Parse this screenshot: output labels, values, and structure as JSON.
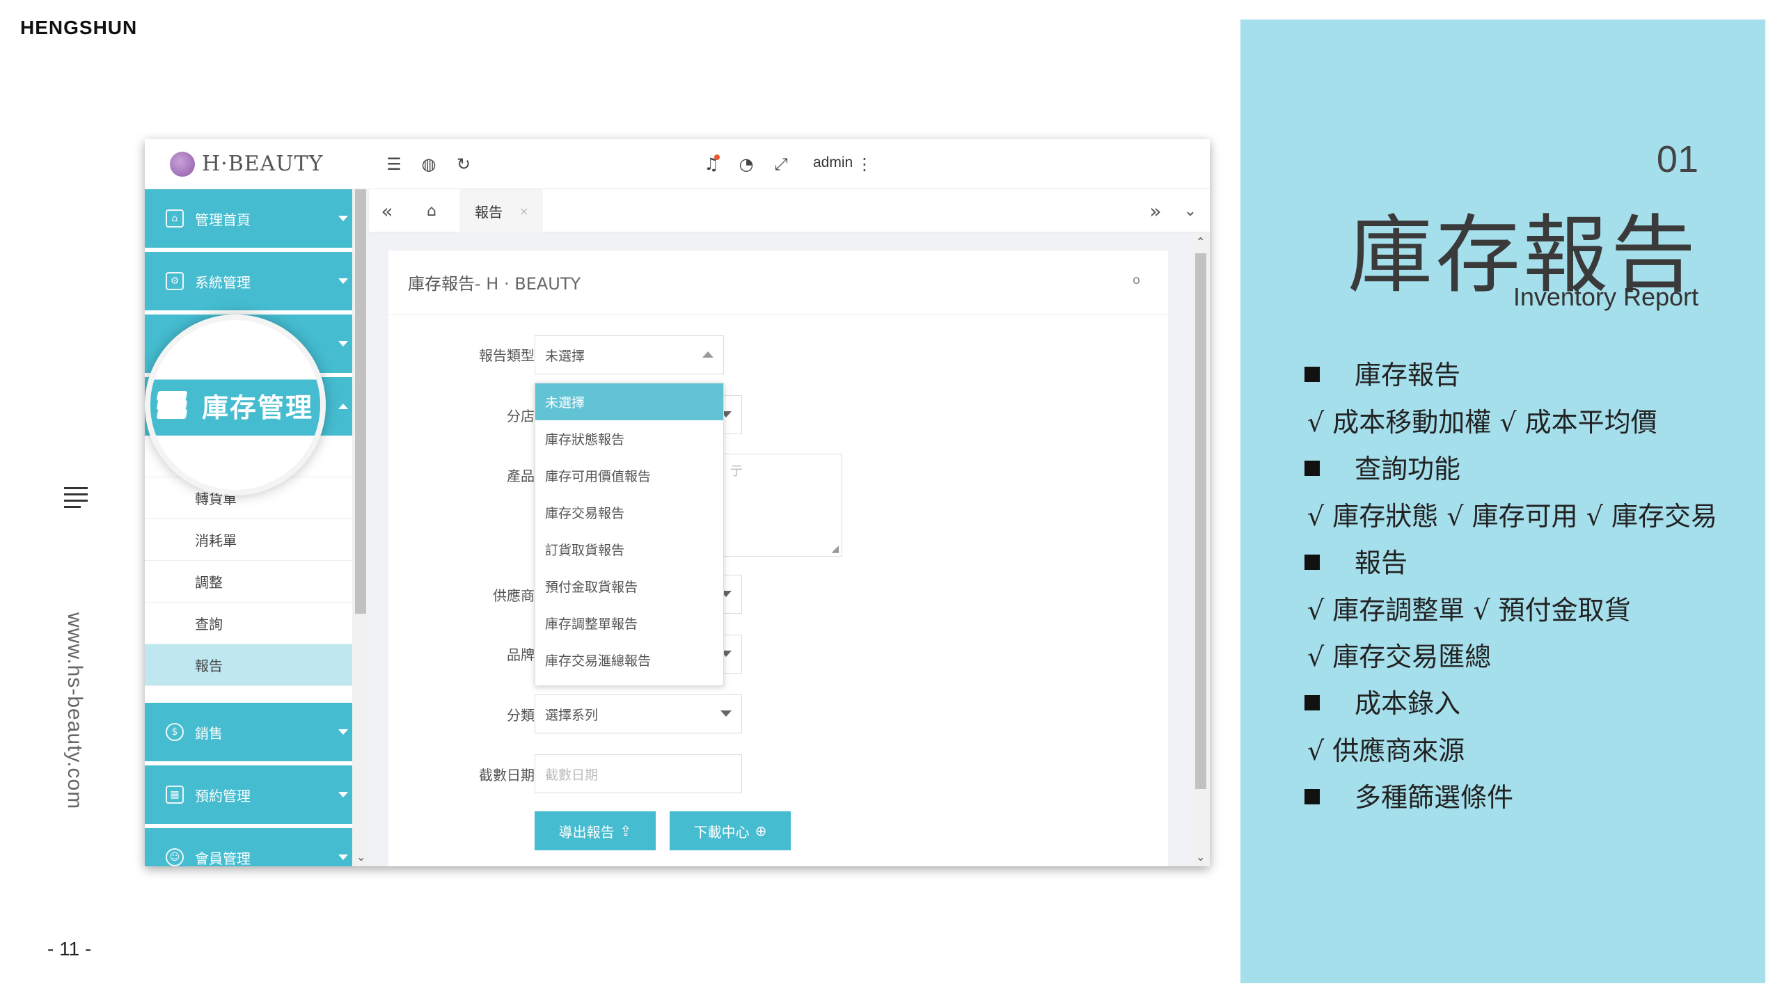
{
  "brand": "HENGSHUN",
  "website": "www.hs-beauty.com",
  "page_number": "- 11 -",
  "app": {
    "logo_text": "H·BEAUTY",
    "menu": {
      "home": "管理首頁",
      "system": "系統管理",
      "inventory": "庫存管理",
      "sales": "銷售",
      "booking": "預約管理",
      "member": "會員管理"
    },
    "submenu": [
      "轉貨單",
      "消耗單",
      "調整",
      "查詢",
      "報告"
    ],
    "topbar": {
      "user": "admin"
    },
    "tab": {
      "label": "報告",
      "close": "×"
    },
    "card": {
      "title": "庫存報告",
      "title_suffix": "- H · BEAUTY",
      "refresh": "o"
    },
    "form": {
      "report_type_label": "報告類型",
      "report_type_value": "未選擇",
      "branch_label": "分店",
      "product_label": "產品",
      "product_hint": "亍",
      "supplier_label": "供應商",
      "brand_label": "品牌",
      "category_label": "分類",
      "category_value": "選擇系列",
      "cutoff_label": "截數日期",
      "cutoff_placeholder": "截數日期"
    },
    "dropdown_options": [
      "未選擇",
      "庫存狀態報告",
      "庫存可用價值報告",
      "庫存交易報告",
      "訂貨取貨報告",
      "預付金取貨報告",
      "庫存調整單報告",
      "庫存交易滙總報告"
    ],
    "buttons": {
      "export": "導出報告",
      "download": "下載中心"
    }
  },
  "panel": {
    "number": "01",
    "title": "庫存報告",
    "subtitle": "Inventory Report",
    "lines": [
      {
        "type": "bullet",
        "text": "庫存報告"
      },
      {
        "type": "check",
        "text": "√ 成本移動加權 √ 成本平均價"
      },
      {
        "type": "bullet",
        "text": "查詢功能"
      },
      {
        "type": "check",
        "text": "√ 庫存狀態 √ 庫存可用 √ 庫存交易"
      },
      {
        "type": "bullet",
        "text": "報告"
      },
      {
        "type": "check",
        "text": "√ 庫存調整單  √ 預付金取貨"
      },
      {
        "type": "check",
        "text": "√ 庫存交易匯總"
      },
      {
        "type": "bullet",
        "text": "成本錄入"
      },
      {
        "type": "check",
        "text": "√ 供應商來源"
      },
      {
        "type": "bullet",
        "text": "多種篩選條件"
      }
    ]
  },
  "colors": {
    "accent": "#45bcd0",
    "panel_bg": "#a6dfec",
    "active_row": "#bfe7f0"
  }
}
